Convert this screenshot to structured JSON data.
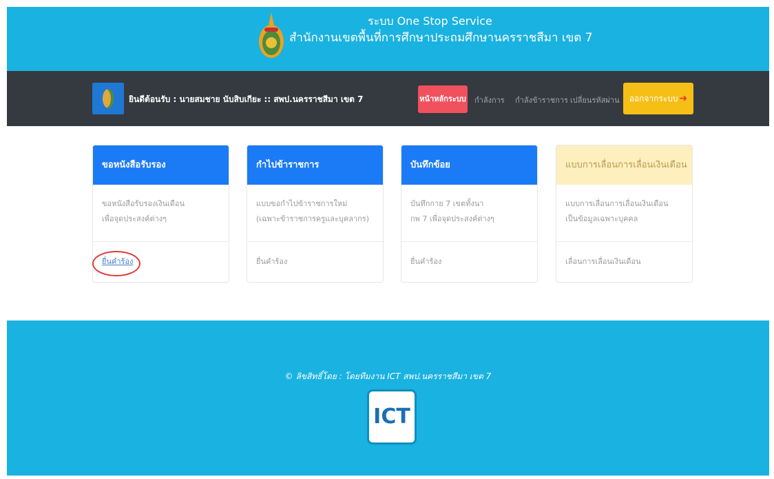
{
  "header": {
    "title_line1": "ระบบ One Stop Service",
    "title_line2": "สำนักงานเขตพื้นที่การศึกษาประถมศึกษานครราชสีมา เขต 7"
  },
  "navbar": {
    "welcome": "ยินดีต้อนรับ : นายสมชาย นับสิบเกียะ :: สพป.นครราชสีมา เขต 7",
    "items": [
      {
        "label": "หน้าหลักระบบ",
        "active": true
      },
      {
        "label": "กำลังการ"
      },
      {
        "label": "กำลังข้าราชการ"
      },
      {
        "label": "เปลี่ยนรหัสผ่าน"
      }
    ],
    "logout_label": "ออกจากระบบ",
    "logout_icon": "sign-out-icon"
  },
  "cards": [
    {
      "title": "ขอหนังสือรับรอง",
      "line1": "ขอหนังสือรับรองเงินเดือน",
      "line2": "เพื่อจุดประสงค์ต่างๆ",
      "action": "ยื่นคำร้อง",
      "action_is_link": true
    },
    {
      "title": "กำไปข้าราชการ",
      "line1": "แบบขอกำไปข้าราชการใหม่",
      "line2": "(เฉพาะข้าราชการครูและบุคลากร)",
      "action": "ยื่นคำร้อง"
    },
    {
      "title": "บันทึกข้อย",
      "line1": "บันทึกกาย 7 เขตทั้งนา",
      "line2": "กพ 7 เพื่อจุดประสงค์ต่างๆ",
      "action": "ยื่นคำร้อง"
    },
    {
      "title": "แบบการเลื่อนการเลื่อนเงินเดือน",
      "line1": "แบบการเลื่อนการเลื่อนเงินเดือน",
      "line2": "เป็นข้อมูลเฉพาะบุคคล",
      "action": "เลื่อนการเลื่อนเงินเดือน"
    }
  ],
  "footer": {
    "text": "© ลิขสิทธิ์โดย : โดยทีมงาน ICT สพป.นครราชสีมา เขต 7",
    "badge": "ICT"
  },
  "colors": {
    "header_bg": "#1ab2e0",
    "navbar_bg": "#343a40",
    "card_blue": "#1b7af5",
    "card_yellow": "#fdefbe",
    "home_red": "#f0515d",
    "logout_yellow": "#f5bf16",
    "highlight_red": "#e03a3a"
  }
}
